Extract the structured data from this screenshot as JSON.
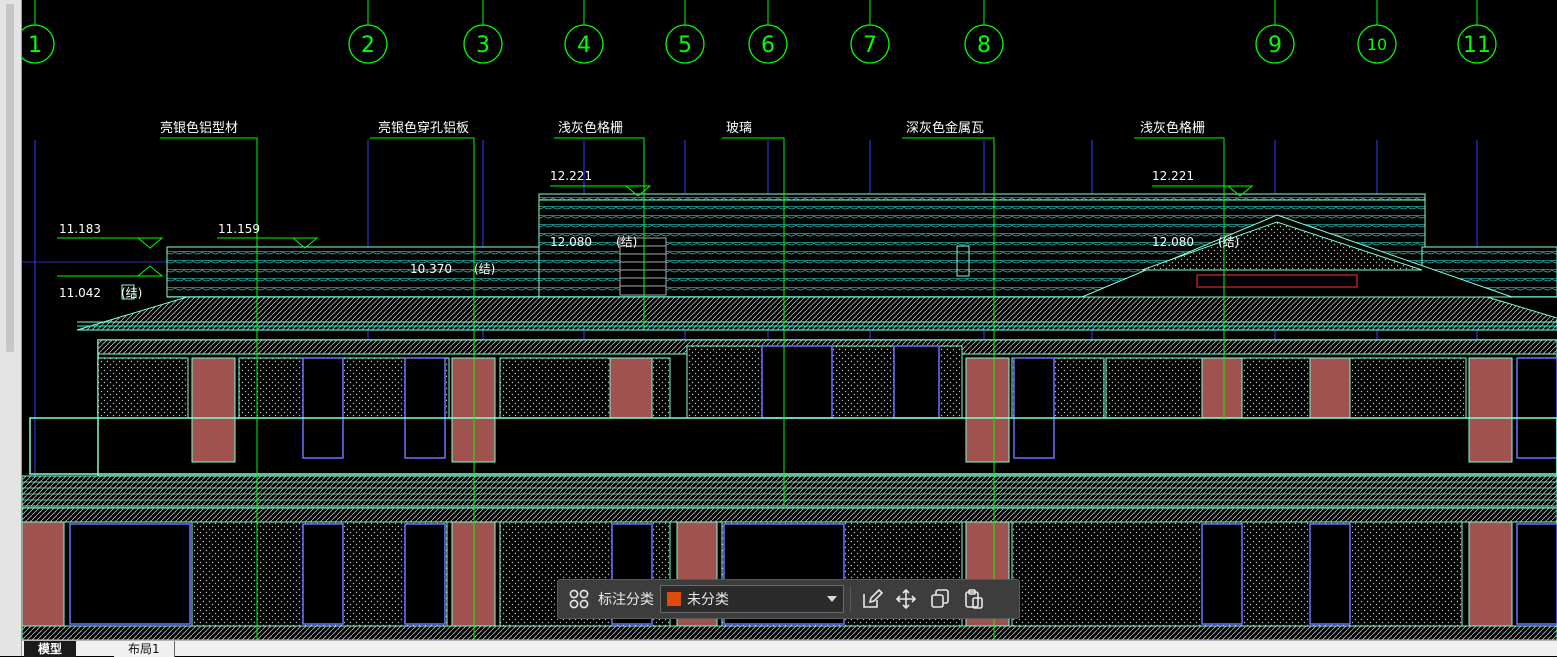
{
  "axes": {
    "labels": [
      "1",
      "2",
      "3",
      "4",
      "5",
      "6",
      "7",
      "8",
      "9",
      "10",
      "11"
    ]
  },
  "annotations": {
    "a1": "亮银色铝型材",
    "a2": "亮银色穿孔铝板",
    "a3": "浅灰色格栅",
    "a4": "玻璃",
    "a5": "深灰色金属瓦",
    "a6": "浅灰色格栅"
  },
  "elevations": {
    "e1": "11.183",
    "e2": "11.159",
    "e3": "11.042",
    "e4": "(结)",
    "e5": "10.370",
    "e6": "(结)",
    "e7": "12.221",
    "e8": "12.080",
    "e9": "(结)",
    "e10": "12.221",
    "e11": "12.080",
    "e12": "(结)"
  },
  "toolbar": {
    "label": "标注分类",
    "category_value": "未分类",
    "category_color": "#e04a0a",
    "icons": [
      "grid-icon",
      "edit-icon",
      "move-icon",
      "copy-icon",
      "paste-icon"
    ]
  },
  "tabs": {
    "model": "模型",
    "layout1": "布局1"
  },
  "colors": {
    "background": "#000000",
    "axis": "#00ff00",
    "structure": "#7fffd4",
    "frame": "#00ffff",
    "glass": "#4040ff",
    "panel": "#a0524f"
  }
}
